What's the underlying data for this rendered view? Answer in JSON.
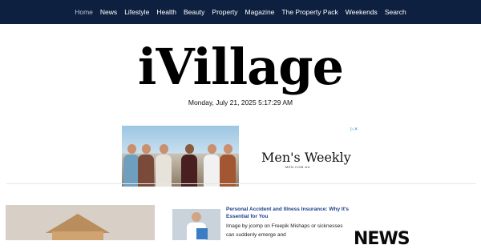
{
  "nav": {
    "items": [
      {
        "label": "Home",
        "active": true
      },
      {
        "label": "News"
      },
      {
        "label": "Lifestyle"
      },
      {
        "label": "Health"
      },
      {
        "label": "Beauty"
      },
      {
        "label": "Property"
      },
      {
        "label": "Magazine"
      },
      {
        "label": "The Property Pack"
      },
      {
        "label": "Weekends"
      },
      {
        "label": "Search"
      }
    ],
    "background": "#0e2040"
  },
  "site": {
    "logo": "iVillage",
    "datetime": "Monday, July 21, 2025 5:17:29 AM"
  },
  "ad": {
    "brand": "Men's Weekly",
    "brand_sub": "MEN.COM.AU"
  },
  "featured_article": {
    "title": "Personal Accident and Illness Insurance: Why It's Essential for You",
    "excerpt": "Image by jcomp on Freepik Mishaps or sicknesses can suddenly emerge and"
  },
  "partner": {
    "logo": "NEWS"
  }
}
